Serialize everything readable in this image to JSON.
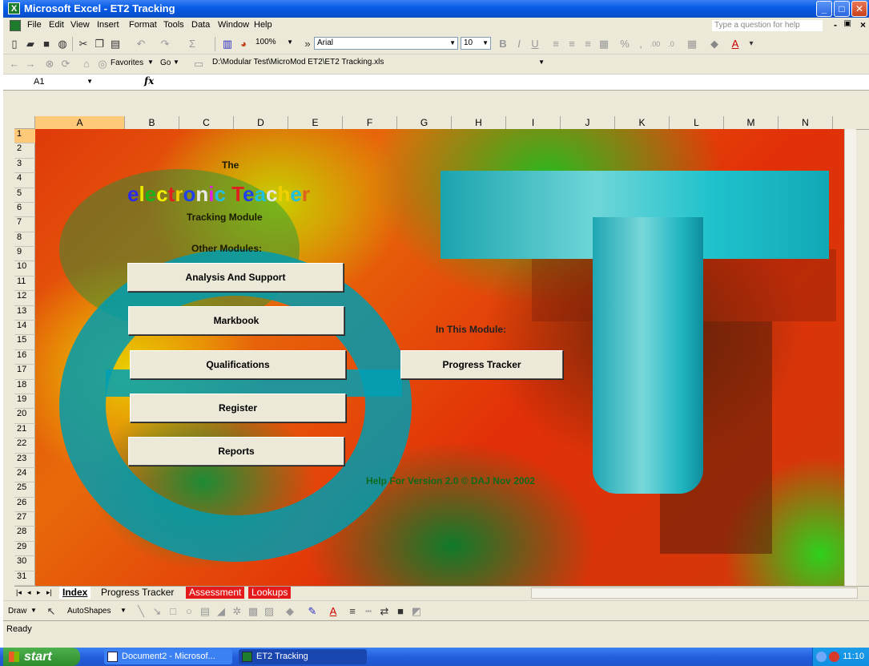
{
  "window": {
    "title": "Microsoft Excel - ET2 Tracking"
  },
  "menu": {
    "items": [
      "File",
      "Edit",
      "View",
      "Insert",
      "Format",
      "Tools",
      "Data",
      "Window",
      "Help"
    ],
    "help_placeholder": "Type a question for help"
  },
  "toolbar": {
    "zoom": "100%",
    "font": "Arial",
    "font_size": "10"
  },
  "web_toolbar": {
    "favorites": "Favorites",
    "go": "Go",
    "path": "D:\\Modular Test\\MicroMod ET2\\ET2 Tracking.xls"
  },
  "formula_bar": {
    "name_box": "A1",
    "fx": "fx",
    "content": ""
  },
  "columns": [
    "A",
    "B",
    "C",
    "D",
    "E",
    "F",
    "G",
    "H",
    "I",
    "J",
    "K",
    "L",
    "M",
    "N"
  ],
  "rows": [
    "1",
    "2",
    "3",
    "4",
    "5",
    "6",
    "7",
    "8",
    "9",
    "10",
    "11",
    "12",
    "13",
    "14",
    "15",
    "16",
    "17",
    "18",
    "19",
    "20",
    "21",
    "22",
    "23",
    "24",
    "25",
    "26",
    "27",
    "28",
    "29",
    "30",
    "31"
  ],
  "sheet": {
    "the": "The",
    "title_letters": [
      {
        "ch": "e",
        "color": "#2B2BEA"
      },
      {
        "ch": "l",
        "color": "#E8E800"
      },
      {
        "ch": "e",
        "color": "#18B418"
      },
      {
        "ch": "c",
        "color": "#F0F000"
      },
      {
        "ch": "t",
        "color": "#E02020"
      },
      {
        "ch": "r",
        "color": "#F0D000"
      },
      {
        "ch": "o",
        "color": "#2040F0"
      },
      {
        "ch": "n",
        "color": "#E8E8E8"
      },
      {
        "ch": "i",
        "color": "#E020E0"
      },
      {
        "ch": "c",
        "color": "#20C0E0"
      },
      {
        "ch": " ",
        "color": "#000000"
      },
      {
        "ch": "T",
        "color": "#E02020"
      },
      {
        "ch": "e",
        "color": "#2040F0"
      },
      {
        "ch": "a",
        "color": "#20C0E0"
      },
      {
        "ch": "c",
        "color": "#E8E8E8"
      },
      {
        "ch": "h",
        "color": "#F0D000"
      },
      {
        "ch": "e",
        "color": "#20C0E0"
      },
      {
        "ch": "r",
        "color": "#E06020"
      }
    ],
    "subtitle": "Tracking Module",
    "other_modules_label": "Other Modules:",
    "in_module_label": "In This Module:",
    "buttons": {
      "analysis": "Analysis And Support",
      "markbook": "Markbook",
      "qualifications": "Qualifications",
      "register": "Register",
      "reports": "Reports",
      "progress": "Progress Tracker"
    },
    "help_text": "Help For Version 2.0 © DAJ Nov 2002"
  },
  "sheet_tabs": [
    {
      "label": "Index",
      "state": "active"
    },
    {
      "label": "Progress Tracker",
      "state": "normal"
    },
    {
      "label": "Assessment",
      "state": "red"
    },
    {
      "label": "Lookups",
      "state": "red"
    }
  ],
  "draw_toolbar": {
    "draw": "Draw",
    "autoshapes": "AutoShapes"
  },
  "status": {
    "text": "Ready"
  },
  "taskbar": {
    "start": "start",
    "tasks": [
      "Document2 - Microsof...",
      "ET2 Tracking"
    ],
    "clock": "11:10"
  },
  "colors": {
    "titlebar": "#0A5EE8",
    "button_face": "#ECE9D8",
    "tab_red": "#E51B1B",
    "title_text_label": "#1A1A00"
  }
}
